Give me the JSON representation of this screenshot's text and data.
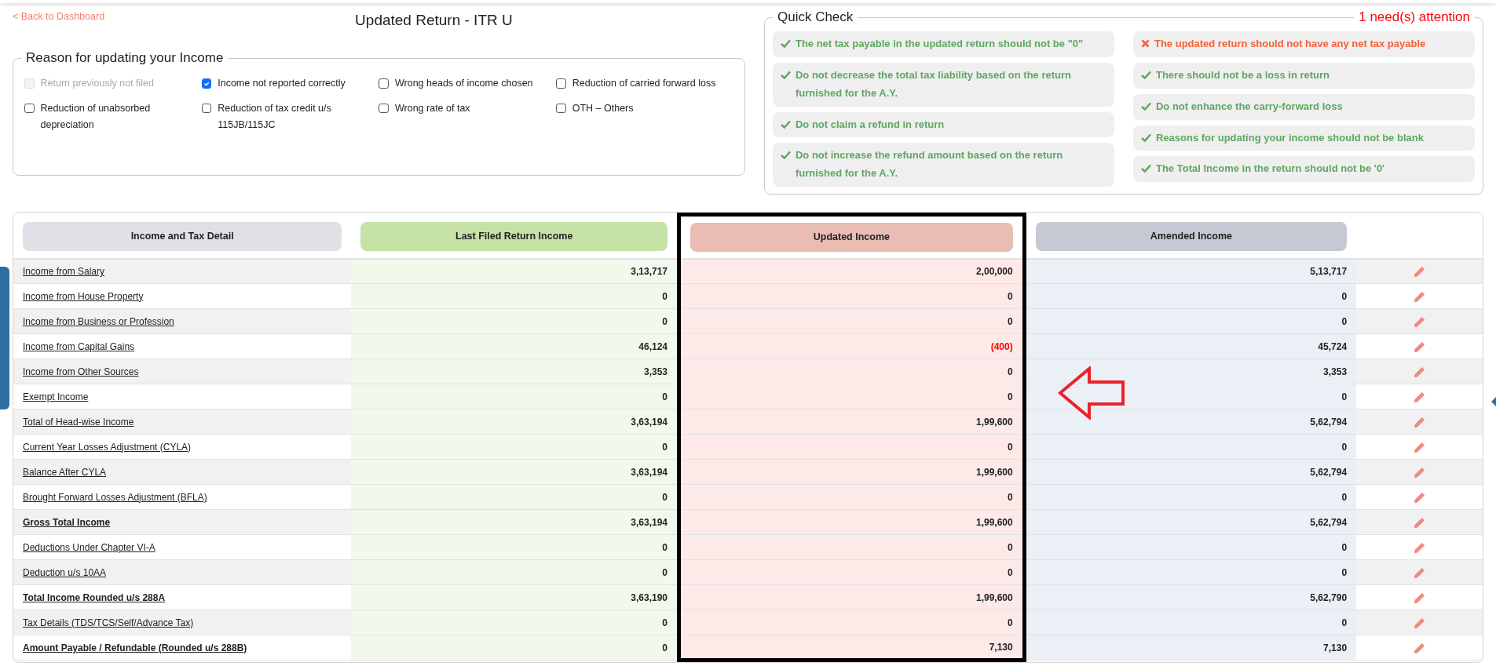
{
  "back_link": "< Back to Dashboard",
  "title": "Updated Return - ITR U",
  "reasons": {
    "title": "Reason for updating your Income",
    "options": [
      {
        "label": "Return previously not filed",
        "checked": false,
        "disabled": true
      },
      {
        "label": "Income not reported correctly",
        "checked": true,
        "disabled": false
      },
      {
        "label": "Wrong heads of income chosen",
        "checked": false,
        "disabled": false
      },
      {
        "label": "Reduction of carried forward loss",
        "checked": false,
        "disabled": false
      },
      {
        "label": "Reduction of unabsorbed depreciation",
        "checked": false,
        "disabled": false
      },
      {
        "label": "Reduction of tax credit u/s 115JB/115JC",
        "checked": false,
        "disabled": false
      },
      {
        "label": "Wrong rate of tax",
        "checked": false,
        "disabled": false
      },
      {
        "label": "OTH – Others",
        "checked": false,
        "disabled": false
      }
    ]
  },
  "quick_check": {
    "title": "Quick Check",
    "attention": "1 need(s) attention",
    "columns": [
      [
        {
          "text": "The net tax payable in the updated return should not be \"0\"",
          "passed": true
        },
        {
          "text": "Do not decrease the total tax liability based on the return furnished for the A.Y.",
          "passed": true
        },
        {
          "text": "Do not claim a refund in return",
          "passed": true
        },
        {
          "text": "Do not increase the refund amount based on the return furnished for the A.Y.",
          "passed": true
        }
      ],
      [
        {
          "text": "The updated return should not have any net tax payable",
          "passed": false
        },
        {
          "text": "There should not be a loss in return",
          "passed": true
        },
        {
          "text": "Do not enhance the carry-forward loss",
          "passed": true
        },
        {
          "text": "Reasons for updating your income should not be blank",
          "passed": true
        },
        {
          "text": "The Total Income in the return should not be '0'",
          "passed": true
        }
      ]
    ]
  },
  "table": {
    "columns": [
      "Income and Tax Detail",
      "Last Filed Return Income",
      "Updated Income",
      "Amended Income"
    ],
    "rows": [
      {
        "label": "Income from Salary",
        "bold": false,
        "last_filed": "3,13,717",
        "updated": "2,00,000",
        "updated_alert": false,
        "amended": "5,13,717"
      },
      {
        "label": "Income from House Property",
        "bold": false,
        "last_filed": "0",
        "updated": "0",
        "updated_alert": false,
        "amended": "0"
      },
      {
        "label": "Income from Business or Profession",
        "bold": false,
        "last_filed": "0",
        "updated": "0",
        "updated_alert": false,
        "amended": "0"
      },
      {
        "label": "Income from Capital Gains",
        "bold": false,
        "last_filed": "46,124",
        "updated": "(400)",
        "updated_alert": true,
        "amended": "45,724"
      },
      {
        "label": "Income from Other Sources",
        "bold": false,
        "last_filed": "3,353",
        "updated": "0",
        "updated_alert": false,
        "amended": "3,353"
      },
      {
        "label": "Exempt Income",
        "bold": false,
        "last_filed": "0",
        "updated": "0",
        "updated_alert": false,
        "amended": "0"
      },
      {
        "label": "Total of Head-wise Income",
        "bold": false,
        "last_filed": "3,63,194",
        "updated": "1,99,600",
        "updated_alert": false,
        "amended": "5,62,794"
      },
      {
        "label": "Current Year Losses Adjustment (CYLA)",
        "bold": false,
        "last_filed": "0",
        "updated": "0",
        "updated_alert": false,
        "amended": "0"
      },
      {
        "label": "Balance After CYLA",
        "bold": false,
        "last_filed": "3,63,194",
        "updated": "1,99,600",
        "updated_alert": false,
        "amended": "5,62,794"
      },
      {
        "label": "Brought Forward Losses Adjustment (BFLA)",
        "bold": false,
        "last_filed": "0",
        "updated": "0",
        "updated_alert": false,
        "amended": "0"
      },
      {
        "label": "Gross Total Income",
        "bold": true,
        "last_filed": "3,63,194",
        "updated": "1,99,600",
        "updated_alert": false,
        "amended": "5,62,794"
      },
      {
        "label": "Deductions Under Chapter VI-A",
        "bold": false,
        "last_filed": "0",
        "updated": "0",
        "updated_alert": false,
        "amended": "0"
      },
      {
        "label": "Deduction u/s 10AA",
        "bold": false,
        "last_filed": "0",
        "updated": "0",
        "updated_alert": false,
        "amended": "0"
      },
      {
        "label": "Total Income Rounded u/s 288A",
        "bold": true,
        "last_filed": "3,63,190",
        "updated": "1,99,600",
        "updated_alert": false,
        "amended": "5,62,790"
      },
      {
        "label": "Tax Details (TDS/TCS/Self/Advance Tax)",
        "bold": false,
        "last_filed": "0",
        "updated": "0",
        "updated_alert": false,
        "amended": "0"
      },
      {
        "label": "Amount Payable / Refundable (Rounded u/s 288B)",
        "bold": true,
        "last_filed": "0",
        "updated": "7,130",
        "updated_alert": false,
        "amended": "7,130"
      }
    ]
  }
}
